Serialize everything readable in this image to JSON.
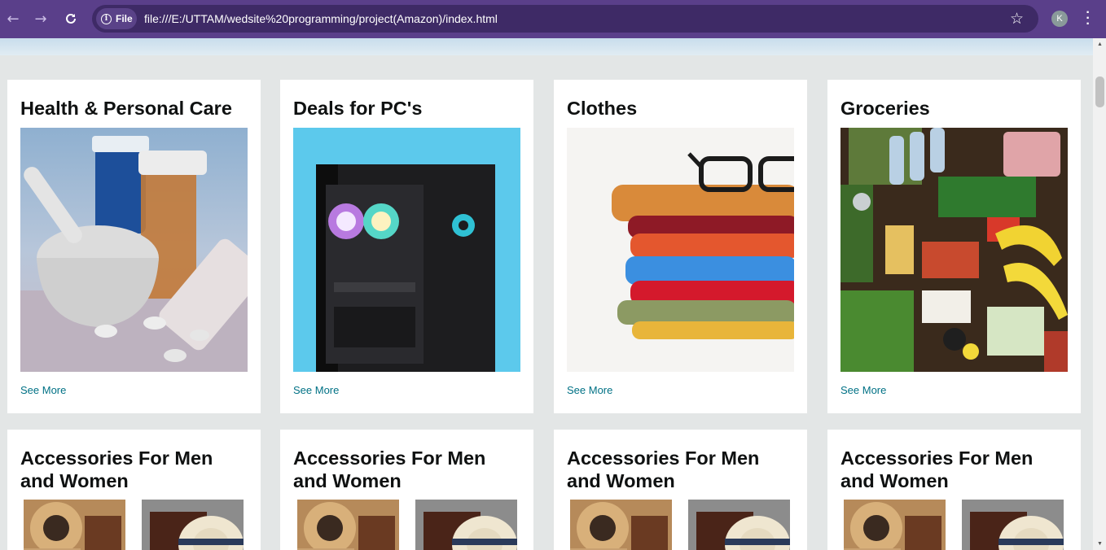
{
  "browser": {
    "chip_label": "File",
    "url": "file:///E:/UTTAM/wedsite%20programming/project(Amazon)/index.html",
    "profile_initial": "K"
  },
  "cards_top": [
    {
      "title": "Health & Personal Care",
      "link": "See More"
    },
    {
      "title": "Deals for PC's",
      "link": "See More"
    },
    {
      "title": "Clothes",
      "link": "See More"
    },
    {
      "title": "Groceries",
      "link": "See More"
    }
  ],
  "cards_bottom": [
    {
      "title": "Accessories For Men and Women"
    },
    {
      "title": "Accessories For Men and Women"
    },
    {
      "title": "Accessories For Men and Women"
    },
    {
      "title": "Accessories For Men and Women"
    }
  ],
  "colors": {
    "chrome": "#5a3f8a",
    "page_bg": "#e3e6e6",
    "link": "#007185"
  },
  "icons": [
    "back-icon",
    "forward-icon",
    "reload-icon",
    "info-icon",
    "star-icon",
    "menu-icon"
  ]
}
